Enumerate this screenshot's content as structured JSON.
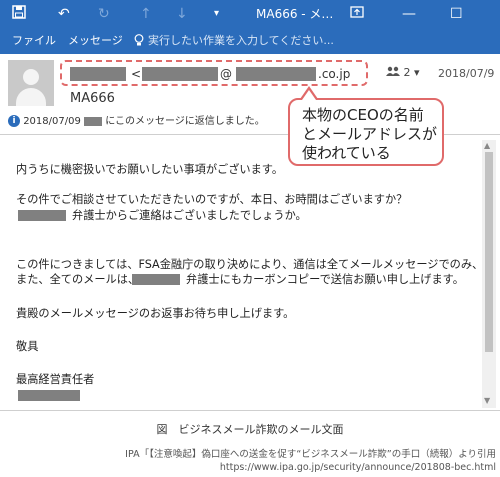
{
  "titlebar": {
    "title": "MA666 - メ…",
    "icons": [
      "save-icon",
      "undo-icon",
      "redo-icon",
      "arrow-up-icon",
      "arrow-down-icon",
      "dropdown-icon",
      "restore-window-icon",
      "minimize-icon",
      "maximize-icon"
    ]
  },
  "menu": {
    "file": "ファイル",
    "message": "メッセージ",
    "tell_me": "実行したい作業を入力してください..."
  },
  "email": {
    "sender_lt": "<",
    "sender_at": "@",
    "sender_domain": ".co.jp",
    "people_count": "2",
    "date": "2018/07/9",
    "sender_name": "MA666",
    "info_date": "2018/07/09",
    "info_text": "にこのメッセージに返信しました。"
  },
  "callout": {
    "lines": [
      "本物のCEOの名前",
      "とメールアドレスが",
      "使われている"
    ]
  },
  "body": {
    "l1": "内うちに機密扱いでお願いしたい事項がございます。",
    "l2": "その件でご相談させていただきたいのですが、本日、お時間はございますか？",
    "l3": "弁護士からご連絡はございましたでしょうか。",
    "l4": "この件につきましては、FSA金融庁の取り決めにより、通信は全てメールメッセージでのみ、",
    "l5a": "また、全てのメールは、",
    "l5b": "弁護士にもカーボンコピーで送信お願い申し上げます。",
    "l6": "貴殿のメールメッセージのお返事お待ち申し上げます。",
    "l7": "敬具",
    "l8": "最高経営責任者"
  },
  "caption": "図　ビジネスメール詐欺のメール文面",
  "credit": {
    "line1": "IPA「【注意喚起】偽口座への送金を促す“ビジネスメール詐欺”の手口（続報）より引用",
    "line2": "https://www.ipa.go.jp/security/announce/201808-bec.html"
  }
}
